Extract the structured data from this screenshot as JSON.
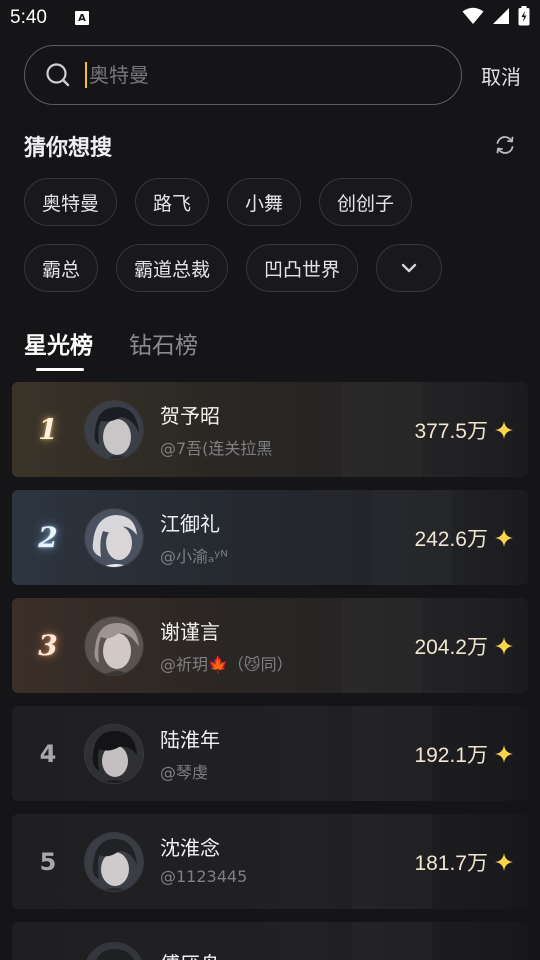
{
  "status": {
    "time": "5:40",
    "a_icon": "A"
  },
  "search": {
    "placeholder": "奥特曼",
    "cancel_label": "取消"
  },
  "guess": {
    "title": "猜你想搜",
    "chips_row1": [
      "奥特曼",
      "路飞",
      "小舞",
      "创创子"
    ],
    "chips_row2": [
      "霸总",
      "霸道总裁",
      "凹凸世界"
    ]
  },
  "tabs": [
    {
      "label": "星光榜",
      "active": true
    },
    {
      "label": "钻石榜",
      "active": false
    }
  ],
  "ranking": [
    {
      "rank": "1",
      "name": "贺予昭",
      "handle": "@7吾(连关拉黑",
      "score": "377.5万"
    },
    {
      "rank": "2",
      "name": "江御礼",
      "handle": "@小渝ₐʸᴺ",
      "score": "242.6万"
    },
    {
      "rank": "3",
      "name": "谢谨言",
      "handle": "@祈玥🍁（😼同）",
      "score": "204.2万"
    },
    {
      "rank": "4",
      "name": "陆淮年",
      "handle": "@琴虔",
      "score": "192.1万"
    },
    {
      "rank": "5",
      "name": "沈淮念",
      "handle": "@1123445",
      "score": "181.7万"
    },
    {
      "rank": "",
      "name": "傅厌舟",
      "handle": "",
      "score": ""
    }
  ],
  "colors": {
    "accent": "#f5c518",
    "background": "#151518"
  },
  "icons": {
    "search": "search-icon",
    "refresh": "refresh-icon",
    "expand": "chevron-down-icon",
    "star": "sparkle-star-icon"
  }
}
